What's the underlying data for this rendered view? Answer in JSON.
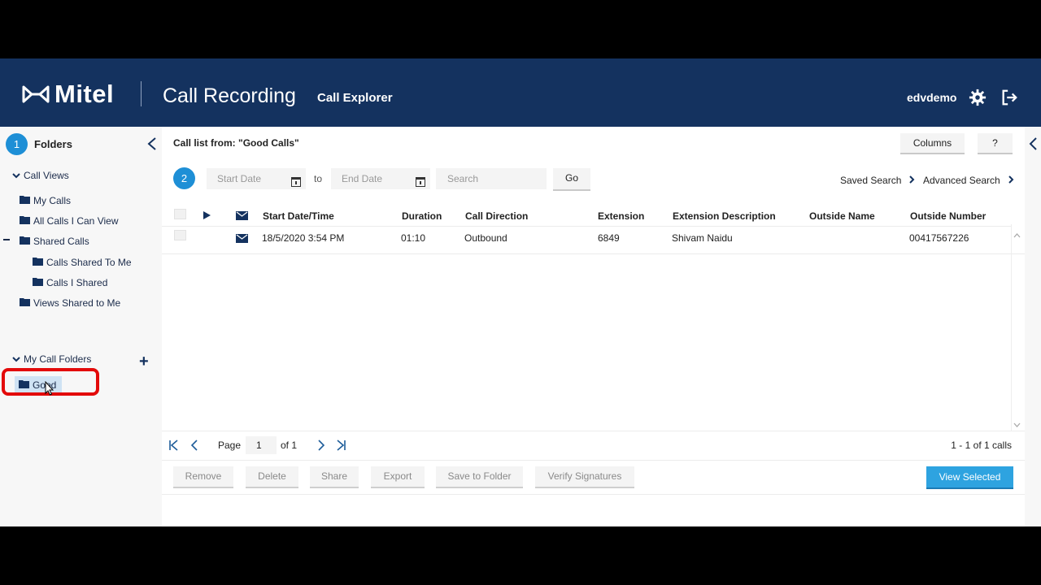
{
  "header": {
    "logo_text": "Mitel",
    "app_title": "Call Recording",
    "app_subtitle": "Call Explorer",
    "username": "edvdemo",
    "icons": [
      "gear-icon",
      "logout-icon"
    ],
    "color": "#14325f"
  },
  "sidebar": {
    "step": "1",
    "title": "Folders",
    "call_views_label": "Call Views",
    "items": [
      {
        "label": "My Calls"
      },
      {
        "label": "All Calls I Can View"
      },
      {
        "label": "Shared Calls"
      },
      {
        "label": "Calls Shared To Me"
      },
      {
        "label": "Calls I Shared"
      },
      {
        "label": "Views Shared to Me"
      }
    ],
    "my_call_folders_label": "My Call Folders",
    "folder_good": "Good"
  },
  "main": {
    "call_list_title": "Call list from: \"Good Calls\"",
    "columns_button": "Columns",
    "help_button": "?",
    "step": "2",
    "start_date_placeholder": "Start Date",
    "to_label": "to",
    "end_date_placeholder": "End Date",
    "search_placeholder": "Search",
    "go_button": "Go",
    "saved_search": "Saved Search",
    "advanced_search": "Advanced Search",
    "table": {
      "headers": [
        "Start Date/Time",
        "Duration",
        "Call Direction",
        "Extension",
        "Extension Description",
        "Outside Name",
        "Outside Number"
      ],
      "rows": [
        {
          "start": "18/5/2020 3:54 PM",
          "duration": "01:10",
          "direction": "Outbound",
          "extension": "6849",
          "ext_desc": "Shivam Naidu",
          "outside_name": "",
          "outside_number": "00417567226"
        }
      ]
    },
    "pager": {
      "page_label": "Page",
      "page_value": "1",
      "of_label": "of 1",
      "count": "1 - 1 of 1 calls"
    },
    "actions": {
      "remove": "Remove",
      "delete": "Delete",
      "share": "Share",
      "export": "Export",
      "save_to_folder": "Save to Folder",
      "verify_signatures": "Verify Signatures",
      "view_selected": "View Selected"
    },
    "accent_color": "#2ea3e0"
  }
}
